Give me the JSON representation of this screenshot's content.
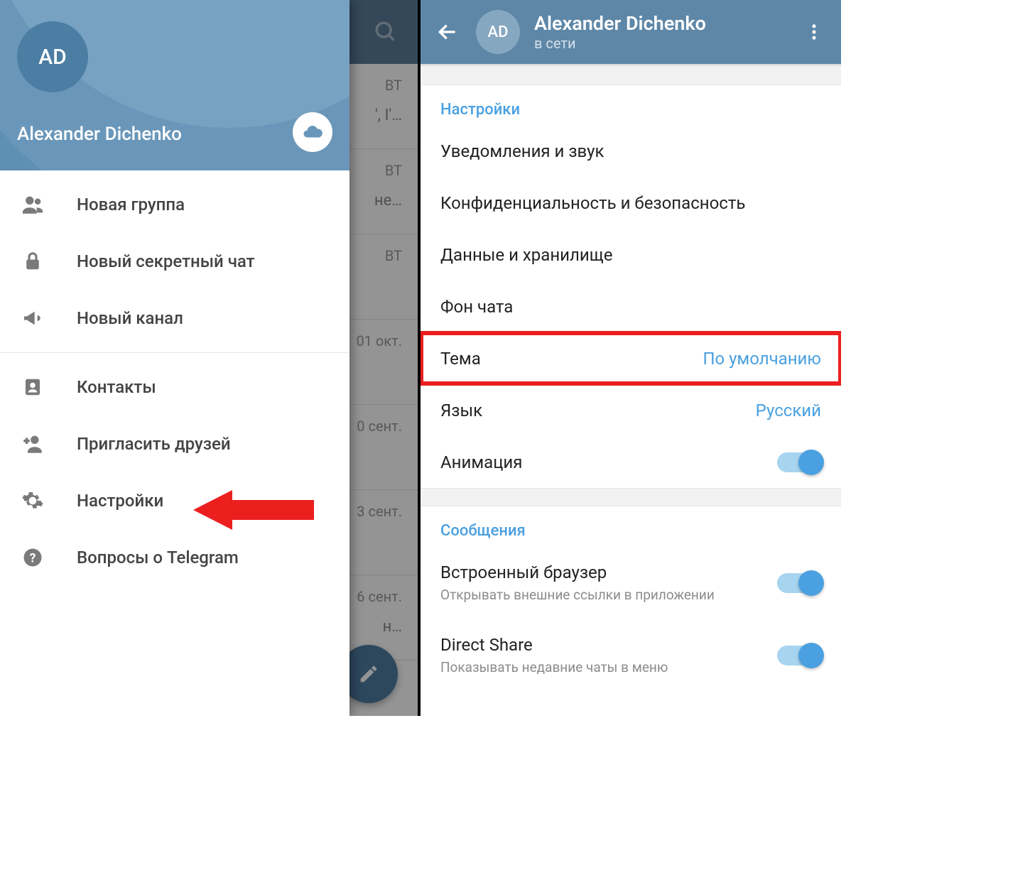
{
  "left": {
    "avatar_initials": "AD",
    "username": "Alexander Dichenko",
    "bg_rows": [
      {
        "date": "ВТ",
        "preview": "', I'…"
      },
      {
        "date": "ВТ",
        "preview": "не…"
      },
      {
        "date": "ВТ",
        "preview": ""
      },
      {
        "date": "01 окт.",
        "preview": ""
      },
      {
        "date": "0 сент.",
        "preview": ""
      },
      {
        "date": "3 сент.",
        "preview": ""
      },
      {
        "date": "6 сент.",
        "preview": "н…"
      }
    ],
    "drawer": {
      "items_top": [
        {
          "icon": "group-icon",
          "label": "Новая группа"
        },
        {
          "icon": "lock-icon",
          "label": "Новый секретный чат"
        },
        {
          "icon": "megaphone-icon",
          "label": "Новый канал"
        }
      ],
      "items_bottom": [
        {
          "icon": "contacts-icon",
          "label": "Контакты"
        },
        {
          "icon": "invite-icon",
          "label": "Пригласить друзей"
        },
        {
          "icon": "gear-icon",
          "label": "Настройки"
        },
        {
          "icon": "help-icon",
          "label": "Вопросы о Telegram"
        }
      ]
    }
  },
  "right": {
    "avatar_initials": "AD",
    "title": "Alexander Dichenko",
    "status": "в сети",
    "section_settings_title": "Настройки",
    "settings_rows": {
      "notifications": "Уведомления и звук",
      "privacy": "Конфиденциальность и безопасность",
      "data": "Данные и хранилище",
      "chat_bg": "Фон чата",
      "theme_label": "Тема",
      "theme_value": "По умолчанию",
      "lang_label": "Язык",
      "lang_value": "Русский",
      "animation": "Анимация"
    },
    "section_messages_title": "Сообщения",
    "messages_rows": {
      "browser_label": "Встроенный браузер",
      "browser_sub": "Открывать внешние ссылки в приложении",
      "direct_label": "Direct Share",
      "direct_sub": "Показывать недавние чаты в меню"
    }
  }
}
